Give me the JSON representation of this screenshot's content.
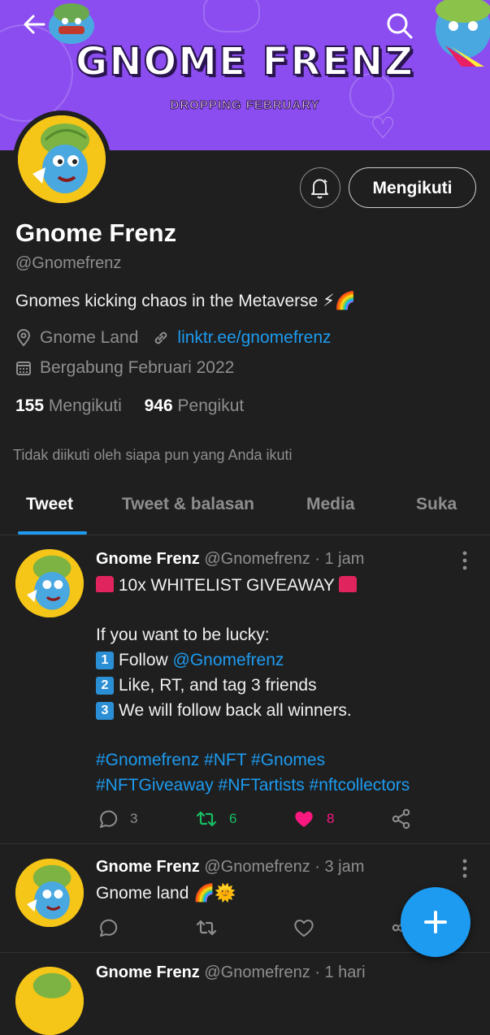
{
  "banner": {
    "title": "GNOME FRENZ",
    "subtitle": "DROPPING FEBRUARY",
    "colors": {
      "bg": "#8b4df0"
    }
  },
  "profile": {
    "name": "Gnome Frenz",
    "handle": "@Gnomefrenz",
    "bio": "Gnomes kicking chaos in the Metaverse ⚡🌈",
    "location": "Gnome Land",
    "link": "linktr.ee/gnomefrenz",
    "joined": "Bergabung Februari 2022",
    "following_count": "155",
    "following_label": "Mengikuti",
    "followers_count": "946",
    "followers_label": "Pengikut",
    "not_followed": "Tidak diikuti oleh siapa pun yang Anda ikuti",
    "follow_button": "Mengikuti"
  },
  "tabs": [
    {
      "label": "Tweet"
    },
    {
      "label": "Tweet & balasan"
    },
    {
      "label": "Media"
    },
    {
      "label": "Suka"
    }
  ],
  "tweets": [
    {
      "name": "Gnome Frenz",
      "handle": "@Gnomefrenz",
      "time": "· 1 jam",
      "line1": "10x WHITELIST GIVEAWAY",
      "line2": "If you want to be lucky:",
      "step1_key": "1",
      "step1_prefix": "Follow ",
      "step1_mention": "@Gnomefrenz",
      "step2_key": "2",
      "step2": "Like, RT, and tag 3 friends",
      "step3_key": "3",
      "step3": "We will follow back all winners.",
      "hashtags1": "#Gnomefrenz #NFT #Gnomes",
      "hashtags2": "#NFTGiveaway #NFTartists #nftcollectors",
      "replies": "3",
      "retweets": "6",
      "likes": "8"
    },
    {
      "name": "Gnome Frenz",
      "handle": "@Gnomefrenz",
      "time": "· 3 jam",
      "text": "Gnome land 🌈🌞"
    },
    {
      "name": "Gnome Frenz",
      "handle": "@Gnomefrenz",
      "time": "· 1 hari"
    }
  ],
  "icons": [
    "back-arrow-icon",
    "search-icon",
    "bell-icon",
    "location-icon",
    "link-icon",
    "calendar-icon",
    "more-icon",
    "reply-icon",
    "retweet-icon",
    "like-icon",
    "share-icon",
    "compose-plus-icon"
  ],
  "colors": {
    "accent": "#1d9bf0",
    "background": "#1f1f1f",
    "retweet": "#17bf63",
    "like": "#f91880"
  }
}
